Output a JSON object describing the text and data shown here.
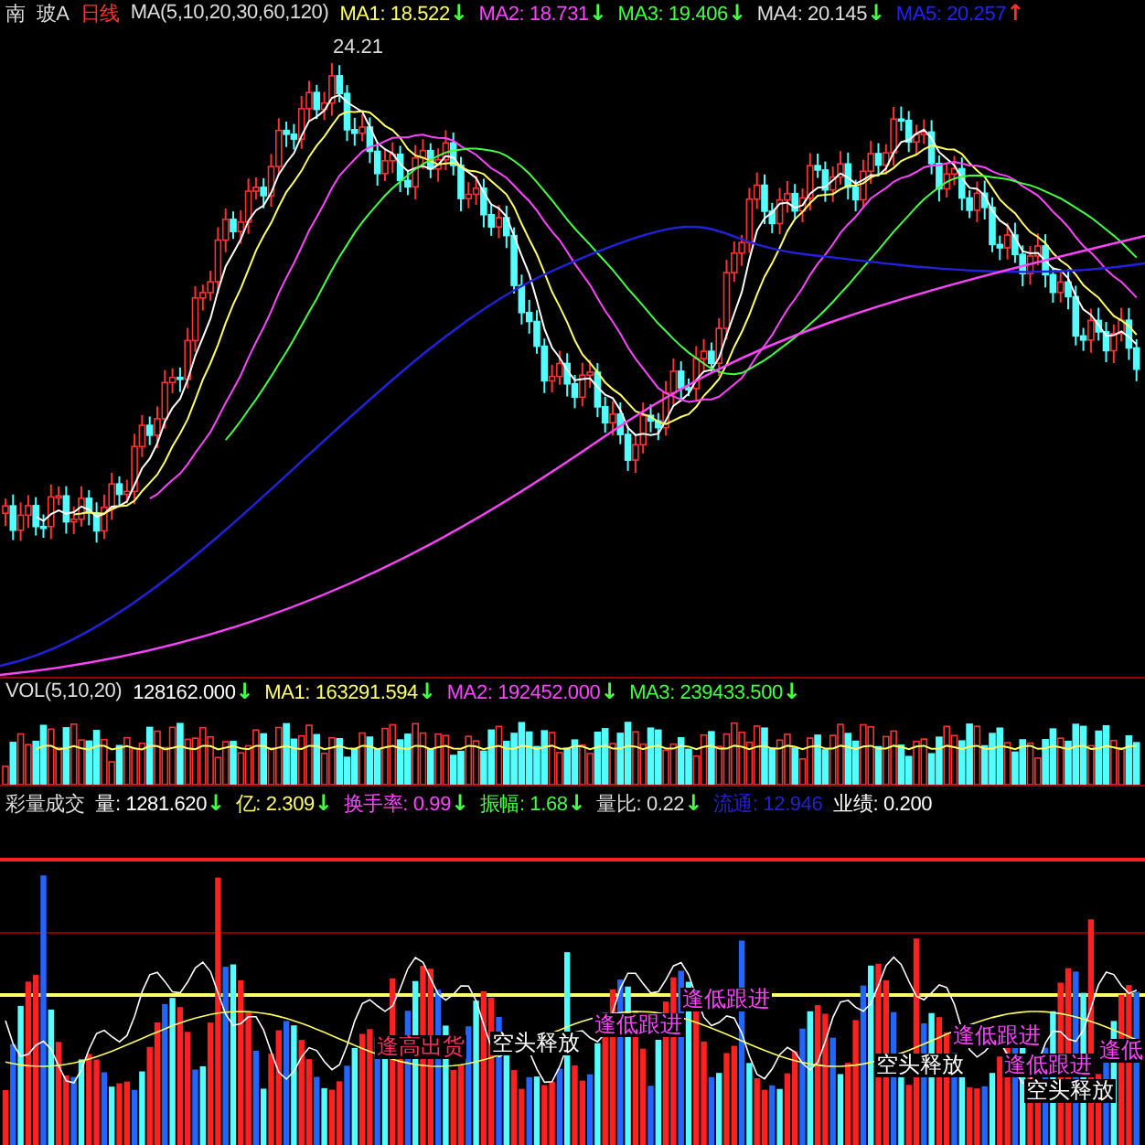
{
  "header": {
    "name": "南",
    "code": "玻A",
    "period": "日线",
    "ma_params": "MA(5,10,20,30,60,120)",
    "readings": [
      {
        "label": "MA1: 18.522",
        "arrow": {
          "text": "↓",
          "color": "#44ff44"
        },
        "color": "#ffff66"
      },
      {
        "label": "MA2: 18.731",
        "arrow": {
          "text": "↓",
          "color": "#44ff44"
        },
        "color": "#ff44ff"
      },
      {
        "label": "MA3: 19.406",
        "arrow": {
          "text": "↓",
          "color": "#44ff44"
        },
        "color": "#44ff44"
      },
      {
        "label": "MA4: 20.145",
        "arrow": {
          "text": "↓",
          "color": "#44ff44"
        },
        "color": "#dddddd"
      },
      {
        "label": "MA5: 20.257",
        "arrow": {
          "text": "↑",
          "color": "#ff3030"
        },
        "color": "#2222ff"
      }
    ]
  },
  "price_pane": {
    "peak_label": "24.21"
  },
  "volume_pane": {
    "title": "VOL(5,10,20)",
    "readings": [
      {
        "label": "128162.000",
        "arrow": {
          "text": "↓",
          "color": "#44ff44"
        },
        "color": "#ffffff"
      },
      {
        "label": "MA1: 163291.594",
        "arrow": {
          "text": "↓",
          "color": "#44ff44"
        },
        "color": "#ffff66"
      },
      {
        "label": "MA2: 192452.000",
        "arrow": {
          "text": "↓",
          "color": "#44ff44"
        },
        "color": "#ff44ff"
      },
      {
        "label": "MA3: 239433.500",
        "arrow": {
          "text": "↓",
          "color": "#44ff44"
        },
        "color": "#44ff44"
      }
    ]
  },
  "indicator_pane": {
    "title": "彩量成交",
    "readings": [
      {
        "label": "量: 1281.620",
        "arrow": {
          "text": "↓",
          "color": "#44ff44"
        },
        "color": "#ffffff"
      },
      {
        "label": "亿: 2.309",
        "arrow": {
          "text": "↓",
          "color": "#44ff44"
        },
        "color": "#ffff66"
      },
      {
        "label": "换手率: 0.99",
        "arrow": {
          "text": "↓",
          "color": "#44ff44"
        },
        "color": "#ff44ff"
      },
      {
        "label": "振幅: 1.68",
        "arrow": {
          "text": "↓",
          "color": "#44ff44"
        },
        "color": "#44ff44"
      },
      {
        "label": "量比: 0.22",
        "arrow": {
          "text": "↓",
          "color": "#44ff44"
        },
        "color": "#dddddd"
      },
      {
        "label": "流通: 12.946",
        "color": "#2222cc"
      },
      {
        "label": "业绩: 0.200",
        "color": "#ffffff"
      }
    ],
    "signals": [
      {
        "text": "逢高出货",
        "kind": "sell"
      },
      {
        "text": "空头释放",
        "kind": "release"
      },
      {
        "text": "逢低跟进",
        "kind": "buy"
      },
      {
        "text": "逢低跟进",
        "kind": "buy"
      },
      {
        "text": "空头释放",
        "kind": "release"
      },
      {
        "text": "逢低跟进",
        "kind": "buy"
      },
      {
        "text": "逢低跟进",
        "kind": "buy"
      },
      {
        "text": "空头释放",
        "kind": "release"
      },
      {
        "text": "逢低",
        "kind": "buy"
      }
    ]
  }
}
